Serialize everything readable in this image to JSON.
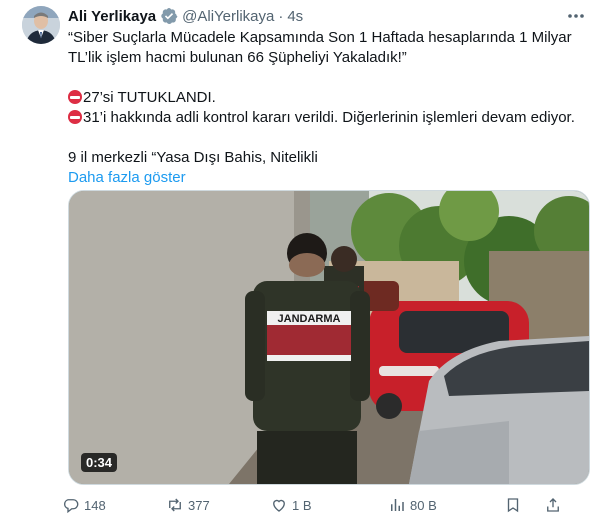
{
  "author": {
    "name": "Ali Yerlikaya",
    "handle": "@AliYerlikaya",
    "separator": "·",
    "time": "4s"
  },
  "tweet": {
    "line1": "“Siber Suçlarla Mücadele Kapsamında Son 1 Haftada hesaplarında 1 Milyar TL’lik işlem hacmi bulunan 66 Şüpheliyi Yakaladık!”",
    "line2": "27’si TUTUKLANDI.",
    "line3": "31’i hakkında adli kontrol kararı verildi. Diğerlerinin işlemleri devam ediyor.",
    "line4": "9 il merkezli “Yasa Dışı Bahis, Nitelikli",
    "show_more": "Daha fazla göster"
  },
  "media": {
    "duration": "0:34",
    "vest_text": "JANDARMA"
  },
  "actions": {
    "replies": "148",
    "reposts": "377",
    "likes": "1 B",
    "views": "80 B"
  },
  "colors": {
    "accent": "#1d9bf0",
    "muted": "#536471",
    "stop_emoji": "#dd2e44"
  }
}
